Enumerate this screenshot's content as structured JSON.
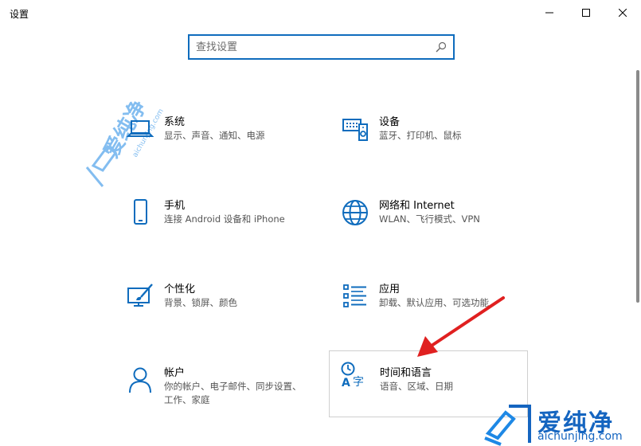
{
  "window": {
    "title": "设置"
  },
  "search": {
    "placeholder": "查找设置"
  },
  "tiles": [
    {
      "title": "系统",
      "desc": "显示、声音、通知、电源",
      "icon": "laptop-icon"
    },
    {
      "title": "设备",
      "desc": "蓝牙、打印机、鼠标",
      "icon": "keyboard-speaker-icon"
    },
    {
      "title": "手机",
      "desc": "连接 Android 设备和 iPhone",
      "icon": "phone-icon"
    },
    {
      "title": "网络和 Internet",
      "desc": "WLAN、飞行模式、VPN",
      "icon": "globe-icon"
    },
    {
      "title": "个性化",
      "desc": "背景、锁屏、颜色",
      "icon": "paint-brush-icon"
    },
    {
      "title": "应用",
      "desc": "卸载、默认应用、可选功能",
      "icon": "app-list-icon"
    },
    {
      "title": "帐户",
      "desc": "你的帐户、电子邮件、同步设置、工作、家庭",
      "icon": "person-icon"
    },
    {
      "title": "时间和语言",
      "desc": "语音、区域、日期",
      "icon": "time-language-icon"
    }
  ],
  "watermark": {
    "name": "爱纯净",
    "site": "aichunjing.com"
  },
  "colors": {
    "accent": "#0f6cbd",
    "annotation_arrow": "#e02020"
  }
}
